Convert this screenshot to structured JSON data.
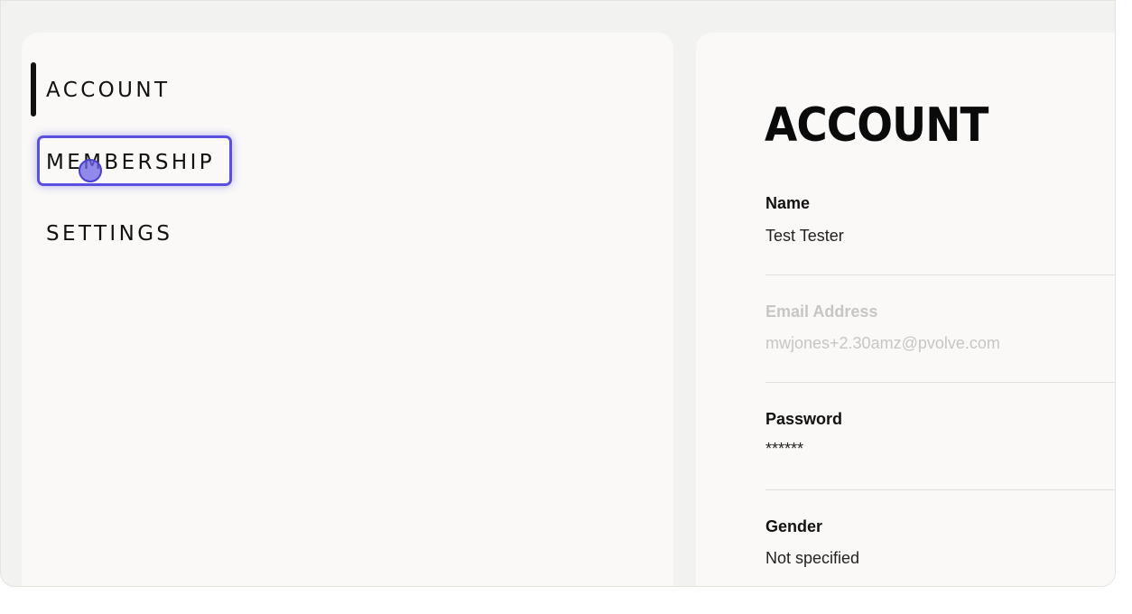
{
  "nav": {
    "items": [
      {
        "label": "ACCOUNT",
        "active": true
      },
      {
        "label": "MEMBERSHIP",
        "focused": true
      },
      {
        "label": "SETTINGS"
      }
    ]
  },
  "account": {
    "title": "ACCOUNT",
    "fields": [
      {
        "label": "Name",
        "value": "Test Tester"
      },
      {
        "label": "Email Address",
        "value": "mwjones+2.30amz@pvolve.com",
        "disabled": true
      },
      {
        "label": "Password",
        "value": "******"
      },
      {
        "label": "Gender",
        "value": "Not specified"
      }
    ]
  },
  "colors": {
    "focus_ring": "#5b4fe0",
    "text": "#111111",
    "muted_text": "#c8c6c2",
    "panel_bg": "#faf9f7",
    "page_bg": "#f2f2f1"
  }
}
